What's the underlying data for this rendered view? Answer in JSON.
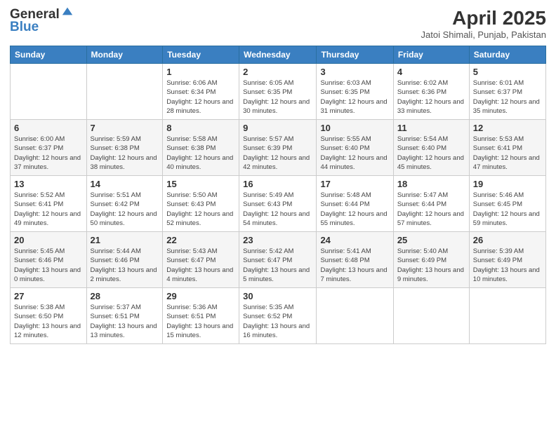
{
  "header": {
    "logo_line1": "General",
    "logo_line2": "Blue",
    "title": "April 2025",
    "subtitle": "Jatoi Shimali, Punjab, Pakistan"
  },
  "days_of_week": [
    "Sunday",
    "Monday",
    "Tuesday",
    "Wednesday",
    "Thursday",
    "Friday",
    "Saturday"
  ],
  "weeks": [
    [
      {
        "day": "",
        "info": ""
      },
      {
        "day": "",
        "info": ""
      },
      {
        "day": "1",
        "info": "Sunrise: 6:06 AM\nSunset: 6:34 PM\nDaylight: 12 hours and 28 minutes."
      },
      {
        "day": "2",
        "info": "Sunrise: 6:05 AM\nSunset: 6:35 PM\nDaylight: 12 hours and 30 minutes."
      },
      {
        "day": "3",
        "info": "Sunrise: 6:03 AM\nSunset: 6:35 PM\nDaylight: 12 hours and 31 minutes."
      },
      {
        "day": "4",
        "info": "Sunrise: 6:02 AM\nSunset: 6:36 PM\nDaylight: 12 hours and 33 minutes."
      },
      {
        "day": "5",
        "info": "Sunrise: 6:01 AM\nSunset: 6:37 PM\nDaylight: 12 hours and 35 minutes."
      }
    ],
    [
      {
        "day": "6",
        "info": "Sunrise: 6:00 AM\nSunset: 6:37 PM\nDaylight: 12 hours and 37 minutes."
      },
      {
        "day": "7",
        "info": "Sunrise: 5:59 AM\nSunset: 6:38 PM\nDaylight: 12 hours and 38 minutes."
      },
      {
        "day": "8",
        "info": "Sunrise: 5:58 AM\nSunset: 6:38 PM\nDaylight: 12 hours and 40 minutes."
      },
      {
        "day": "9",
        "info": "Sunrise: 5:57 AM\nSunset: 6:39 PM\nDaylight: 12 hours and 42 minutes."
      },
      {
        "day": "10",
        "info": "Sunrise: 5:55 AM\nSunset: 6:40 PM\nDaylight: 12 hours and 44 minutes."
      },
      {
        "day": "11",
        "info": "Sunrise: 5:54 AM\nSunset: 6:40 PM\nDaylight: 12 hours and 45 minutes."
      },
      {
        "day": "12",
        "info": "Sunrise: 5:53 AM\nSunset: 6:41 PM\nDaylight: 12 hours and 47 minutes."
      }
    ],
    [
      {
        "day": "13",
        "info": "Sunrise: 5:52 AM\nSunset: 6:41 PM\nDaylight: 12 hours and 49 minutes."
      },
      {
        "day": "14",
        "info": "Sunrise: 5:51 AM\nSunset: 6:42 PM\nDaylight: 12 hours and 50 minutes."
      },
      {
        "day": "15",
        "info": "Sunrise: 5:50 AM\nSunset: 6:43 PM\nDaylight: 12 hours and 52 minutes."
      },
      {
        "day": "16",
        "info": "Sunrise: 5:49 AM\nSunset: 6:43 PM\nDaylight: 12 hours and 54 minutes."
      },
      {
        "day": "17",
        "info": "Sunrise: 5:48 AM\nSunset: 6:44 PM\nDaylight: 12 hours and 55 minutes."
      },
      {
        "day": "18",
        "info": "Sunrise: 5:47 AM\nSunset: 6:44 PM\nDaylight: 12 hours and 57 minutes."
      },
      {
        "day": "19",
        "info": "Sunrise: 5:46 AM\nSunset: 6:45 PM\nDaylight: 12 hours and 59 minutes."
      }
    ],
    [
      {
        "day": "20",
        "info": "Sunrise: 5:45 AM\nSunset: 6:46 PM\nDaylight: 13 hours and 0 minutes."
      },
      {
        "day": "21",
        "info": "Sunrise: 5:44 AM\nSunset: 6:46 PM\nDaylight: 13 hours and 2 minutes."
      },
      {
        "day": "22",
        "info": "Sunrise: 5:43 AM\nSunset: 6:47 PM\nDaylight: 13 hours and 4 minutes."
      },
      {
        "day": "23",
        "info": "Sunrise: 5:42 AM\nSunset: 6:47 PM\nDaylight: 13 hours and 5 minutes."
      },
      {
        "day": "24",
        "info": "Sunrise: 5:41 AM\nSunset: 6:48 PM\nDaylight: 13 hours and 7 minutes."
      },
      {
        "day": "25",
        "info": "Sunrise: 5:40 AM\nSunset: 6:49 PM\nDaylight: 13 hours and 9 minutes."
      },
      {
        "day": "26",
        "info": "Sunrise: 5:39 AM\nSunset: 6:49 PM\nDaylight: 13 hours and 10 minutes."
      }
    ],
    [
      {
        "day": "27",
        "info": "Sunrise: 5:38 AM\nSunset: 6:50 PM\nDaylight: 13 hours and 12 minutes."
      },
      {
        "day": "28",
        "info": "Sunrise: 5:37 AM\nSunset: 6:51 PM\nDaylight: 13 hours and 13 minutes."
      },
      {
        "day": "29",
        "info": "Sunrise: 5:36 AM\nSunset: 6:51 PM\nDaylight: 13 hours and 15 minutes."
      },
      {
        "day": "30",
        "info": "Sunrise: 5:35 AM\nSunset: 6:52 PM\nDaylight: 13 hours and 16 minutes."
      },
      {
        "day": "",
        "info": ""
      },
      {
        "day": "",
        "info": ""
      },
      {
        "day": "",
        "info": ""
      }
    ]
  ]
}
